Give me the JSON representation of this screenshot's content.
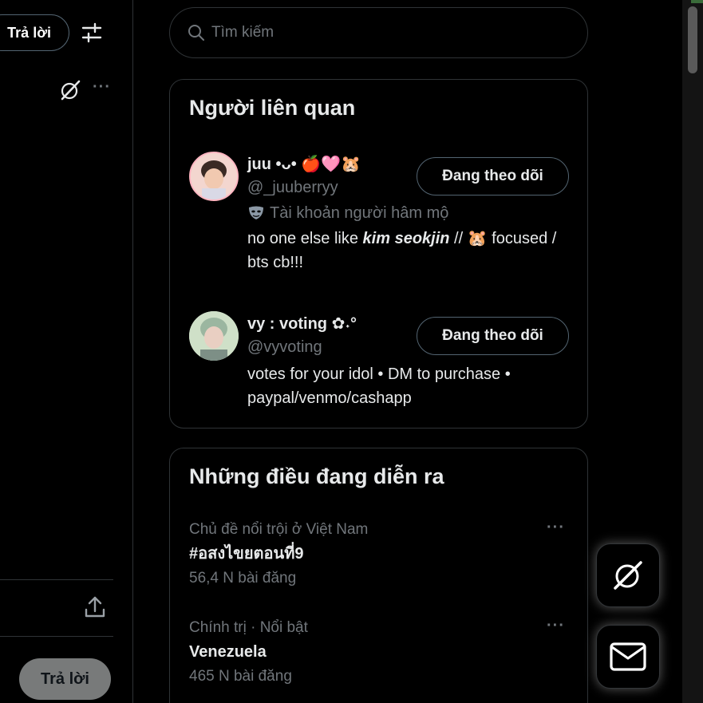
{
  "left": {
    "reply_top_label": "Trả lời",
    "reply_bottom_label": "Trả lời"
  },
  "search": {
    "placeholder": "Tìm kiếm"
  },
  "related": {
    "title": "Người liên quan",
    "users": [
      {
        "name": "juu •ᴗ• 🍎🩷🐹",
        "handle": "@_juuberryy",
        "label": "Tài khoản người hâm mộ",
        "bio_prefix": "no one else like ",
        "bio_bold": "kim seokjin",
        "bio_suffix": " // 🐹 focused / bts cb!!!",
        "follow_label": "Đang theo dõi"
      },
      {
        "name": "vy : voting ✿˖°",
        "handle": "@vyvoting",
        "bio": "votes for your idol • DM to purchase • paypal/venmo/cashapp",
        "follow_label": "Đang theo dõi"
      }
    ]
  },
  "trends": {
    "title": "Những điều đang diễn ra",
    "items": [
      {
        "context": "Chủ đề nổi trội ở Việt Nam",
        "name": "#อสงไขยตอนที่9",
        "count": "56,4 N bài đăng"
      },
      {
        "context": "Chính trị · Nổi bật",
        "name": "Venezuela",
        "count": "465 N bài đăng"
      }
    ]
  },
  "icons": {
    "filter": "sliders-icon",
    "grok": "grok-icon",
    "more": "more-icon",
    "share": "share-icon",
    "search": "search-icon",
    "mail": "mail-icon"
  },
  "colors": {
    "background": "#000000",
    "text": "#e7e9ea",
    "muted": "#71767b",
    "border": "#2f3336"
  }
}
